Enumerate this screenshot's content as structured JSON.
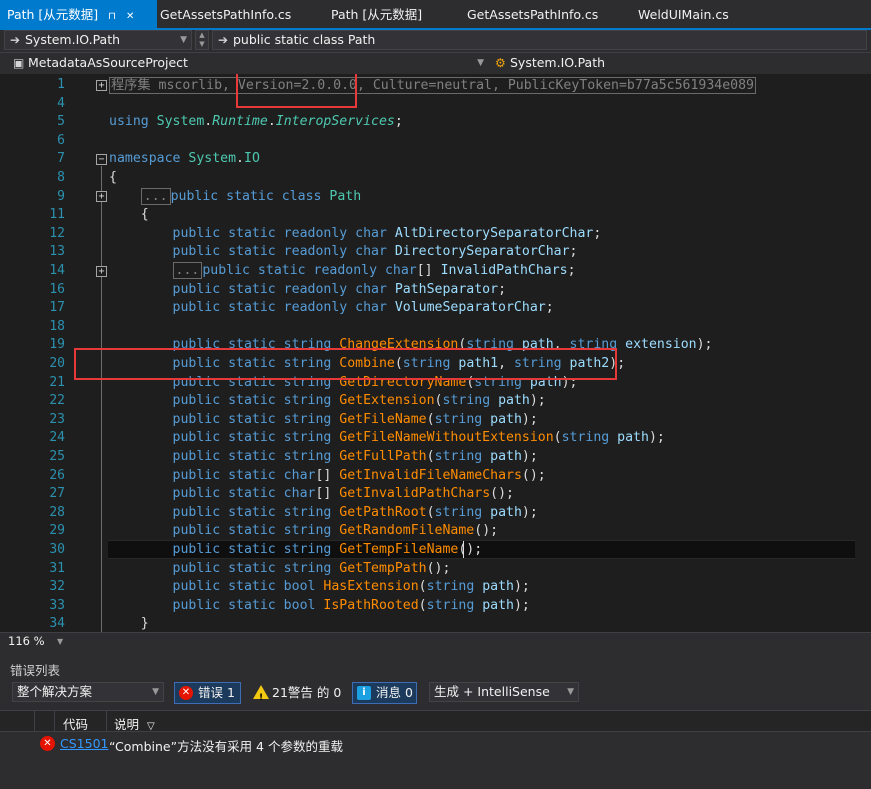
{
  "tabs": [
    {
      "label": "Path [从元数据]",
      "active": true,
      "icons": [
        "pin-icon",
        "close-icon"
      ]
    },
    {
      "label": "GetAssetsPathInfo.cs"
    },
    {
      "label": "Path [从元数据]"
    },
    {
      "label": "GetAssetsPathInfo.cs"
    },
    {
      "label": "WeldUIMain.cs"
    }
  ],
  "nav1": {
    "type_combo": "System.IO.Path",
    "member_combo": "public static class Path"
  },
  "nav2": {
    "project_combo": "MetadataAsSourceProject",
    "type_combo": "System.IO.Path"
  },
  "editor": {
    "lines": [
      {
        "n": "1",
        "tokens": [
          [
            "grey",
            "程序集 mscorlib, Version=2.0.0.0, Culture=neutral, PublicKeyToken=b77a5c561934e089"
          ]
        ]
      },
      {
        "n": "4",
        "tokens": []
      },
      {
        "n": "5",
        "tokens": [
          [
            "kw",
            "using "
          ],
          [
            "ty",
            "System"
          ],
          [
            "plain",
            "."
          ],
          [
            "it",
            "Runtime"
          ],
          [
            "plain",
            "."
          ],
          [
            "it",
            "InteropServices"
          ],
          [
            "plain",
            ";"
          ]
        ]
      },
      {
        "n": "6",
        "tokens": []
      },
      {
        "n": "7",
        "tokens": [
          [
            "kw",
            "namespace "
          ],
          [
            "ty",
            "System"
          ],
          [
            "plain",
            "."
          ],
          [
            "ty",
            "IO"
          ]
        ]
      },
      {
        "n": "8",
        "tokens": [
          [
            "plain",
            "{"
          ]
        ]
      },
      {
        "n": "9",
        "tokens": [
          [
            "plain",
            "    "
          ],
          [
            "collapsed",
            "..."
          ],
          [
            "kw",
            "public static class "
          ],
          [
            "ty",
            "Path"
          ]
        ]
      },
      {
        "n": "11",
        "tokens": [
          [
            "plain",
            "    {"
          ]
        ]
      },
      {
        "n": "12",
        "tokens": [
          [
            "plain",
            "        "
          ],
          [
            "kw",
            "public static readonly char "
          ],
          [
            "pn",
            "AltDirectorySeparatorChar"
          ],
          [
            "plain",
            ";"
          ]
        ]
      },
      {
        "n": "13",
        "tokens": [
          [
            "plain",
            "        "
          ],
          [
            "kw",
            "public static readonly char "
          ],
          [
            "pn",
            "DirectorySeparatorChar"
          ],
          [
            "plain",
            ";"
          ]
        ]
      },
      {
        "n": "14",
        "tokens": [
          [
            "plain",
            "        "
          ],
          [
            "collapsed",
            "..."
          ],
          [
            "kw",
            "public static readonly char"
          ],
          [
            "plain",
            "[] "
          ],
          [
            "pn",
            "InvalidPathChars"
          ],
          [
            "plain",
            ";"
          ]
        ]
      },
      {
        "n": "16",
        "tokens": [
          [
            "plain",
            "        "
          ],
          [
            "kw",
            "public static readonly char "
          ],
          [
            "pn",
            "PathSeparator"
          ],
          [
            "plain",
            ";"
          ]
        ]
      },
      {
        "n": "17",
        "tokens": [
          [
            "plain",
            "        "
          ],
          [
            "kw",
            "public static readonly char "
          ],
          [
            "pn",
            "VolumeSeparatorChar"
          ],
          [
            "plain",
            ";"
          ]
        ]
      },
      {
        "n": "18",
        "tokens": []
      },
      {
        "n": "19",
        "tokens": [
          [
            "plain",
            "        "
          ],
          [
            "kw",
            "public static string "
          ],
          [
            "mt",
            "ChangeExtension"
          ],
          [
            "plain",
            "("
          ],
          [
            "kw",
            "string "
          ],
          [
            "pn",
            "path"
          ],
          [
            "plain",
            ", "
          ],
          [
            "kw",
            "string "
          ],
          [
            "pn",
            "extension"
          ],
          [
            "plain",
            ");"
          ]
        ]
      },
      {
        "n": "20",
        "tokens": [
          [
            "plain",
            "        "
          ],
          [
            "kw",
            "public static string "
          ],
          [
            "mt",
            "Combine"
          ],
          [
            "plain",
            "("
          ],
          [
            "kw",
            "string "
          ],
          [
            "pn",
            "path1"
          ],
          [
            "plain",
            ", "
          ],
          [
            "kw",
            "string "
          ],
          [
            "pn",
            "path2"
          ],
          [
            "plain",
            ");"
          ]
        ]
      },
      {
        "n": "21",
        "tokens": [
          [
            "plain",
            "        "
          ],
          [
            "kw",
            "public static string "
          ],
          [
            "mt",
            "GetDirectoryName"
          ],
          [
            "plain",
            "("
          ],
          [
            "kw",
            "string "
          ],
          [
            "pn",
            "path"
          ],
          [
            "plain",
            ");"
          ]
        ]
      },
      {
        "n": "22",
        "tokens": [
          [
            "plain",
            "        "
          ],
          [
            "kw",
            "public static string "
          ],
          [
            "mt",
            "GetExtension"
          ],
          [
            "plain",
            "("
          ],
          [
            "kw",
            "string "
          ],
          [
            "pn",
            "path"
          ],
          [
            "plain",
            ");"
          ]
        ]
      },
      {
        "n": "23",
        "tokens": [
          [
            "plain",
            "        "
          ],
          [
            "kw",
            "public static string "
          ],
          [
            "mt",
            "GetFileName"
          ],
          [
            "plain",
            "("
          ],
          [
            "kw",
            "string "
          ],
          [
            "pn",
            "path"
          ],
          [
            "plain",
            ");"
          ]
        ]
      },
      {
        "n": "24",
        "tokens": [
          [
            "plain",
            "        "
          ],
          [
            "kw",
            "public static string "
          ],
          [
            "mt",
            "GetFileNameWithoutExtension"
          ],
          [
            "plain",
            "("
          ],
          [
            "kw",
            "string "
          ],
          [
            "pn",
            "path"
          ],
          [
            "plain",
            ");"
          ]
        ]
      },
      {
        "n": "25",
        "tokens": [
          [
            "plain",
            "        "
          ],
          [
            "kw",
            "public static string "
          ],
          [
            "mt",
            "GetFullPath"
          ],
          [
            "plain",
            "("
          ],
          [
            "kw",
            "string "
          ],
          [
            "pn",
            "path"
          ],
          [
            "plain",
            ");"
          ]
        ]
      },
      {
        "n": "26",
        "tokens": [
          [
            "plain",
            "        "
          ],
          [
            "kw",
            "public static char"
          ],
          [
            "plain",
            "[] "
          ],
          [
            "mt",
            "GetInvalidFileNameChars"
          ],
          [
            "plain",
            "();"
          ]
        ]
      },
      {
        "n": "27",
        "tokens": [
          [
            "plain",
            "        "
          ],
          [
            "kw",
            "public static char"
          ],
          [
            "plain",
            "[] "
          ],
          [
            "mt",
            "GetInvalidPathChars"
          ],
          [
            "plain",
            "();"
          ]
        ]
      },
      {
        "n": "28",
        "tokens": [
          [
            "plain",
            "        "
          ],
          [
            "kw",
            "public static string "
          ],
          [
            "mt",
            "GetPathRoot"
          ],
          [
            "plain",
            "("
          ],
          [
            "kw",
            "string "
          ],
          [
            "pn",
            "path"
          ],
          [
            "plain",
            ");"
          ]
        ]
      },
      {
        "n": "29",
        "tokens": [
          [
            "plain",
            "        "
          ],
          [
            "kw",
            "public static string "
          ],
          [
            "mt",
            "GetRandomFileName"
          ],
          [
            "plain",
            "();"
          ]
        ]
      },
      {
        "n": "30",
        "tokens": [
          [
            "plain",
            "        "
          ],
          [
            "kw",
            "public static string "
          ],
          [
            "mt",
            "GetTempFileName"
          ],
          [
            "plain",
            "();"
          ]
        ]
      },
      {
        "n": "31",
        "tokens": [
          [
            "plain",
            "        "
          ],
          [
            "kw",
            "public static string "
          ],
          [
            "mt",
            "GetTempPath"
          ],
          [
            "plain",
            "();"
          ]
        ]
      },
      {
        "n": "32",
        "tokens": [
          [
            "plain",
            "        "
          ],
          [
            "kw",
            "public static bool "
          ],
          [
            "mt",
            "HasExtension"
          ],
          [
            "plain",
            "("
          ],
          [
            "kw",
            "string "
          ],
          [
            "pn",
            "path"
          ],
          [
            "plain",
            ");"
          ]
        ]
      },
      {
        "n": "33",
        "tokens": [
          [
            "plain",
            "        "
          ],
          [
            "kw",
            "public static bool "
          ],
          [
            "mt",
            "IsPathRooted"
          ],
          [
            "plain",
            "("
          ],
          [
            "kw",
            "string "
          ],
          [
            "pn",
            "path"
          ],
          [
            "plain",
            ");"
          ]
        ]
      },
      {
        "n": "34",
        "tokens": [
          [
            "plain",
            "    }"
          ]
        ]
      }
    ]
  },
  "zoom": "116 %",
  "error_list": {
    "title": "错误列表",
    "scope": "整个解决方案",
    "errors_label": "错误 1",
    "warnings_label": "21警告 的 0",
    "messages_label": "消息 0",
    "build_filter": "生成 + IntelliSense",
    "col_code": "代码",
    "col_desc": "说明",
    "rows": [
      {
        "code": "CS1501",
        "description": "“Combine”方法没有采用 4 个参数的重载"
      }
    ]
  },
  "colors": {
    "accent": "#007acc",
    "highlight_box": "#e8393a",
    "error": "#e51400",
    "warning": "#f2c811"
  }
}
